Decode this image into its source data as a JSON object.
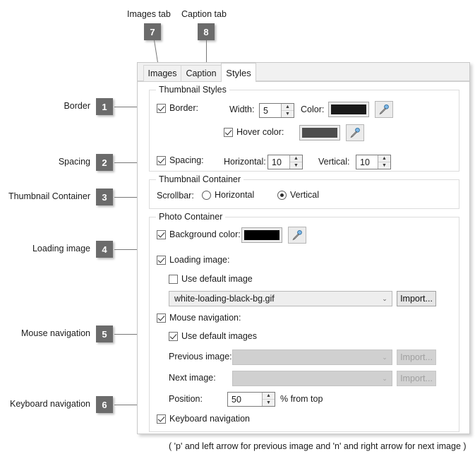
{
  "annotations": {
    "top": [
      {
        "label": "Images tab",
        "number": "7"
      },
      {
        "label": "Caption tab",
        "number": "8"
      }
    ],
    "left": [
      {
        "label": "Border",
        "number": "1"
      },
      {
        "label": "Spacing",
        "number": "2"
      },
      {
        "label": "Thumbnail Container",
        "number": "3"
      },
      {
        "label": "Loading image",
        "number": "4"
      },
      {
        "label": "Mouse navigation",
        "number": "5"
      },
      {
        "label": "Keyboard navigation",
        "number": "6"
      }
    ]
  },
  "tabs": [
    {
      "label": "Images",
      "active": false
    },
    {
      "label": "Caption",
      "active": false
    },
    {
      "label": "Styles",
      "active": true
    }
  ],
  "thumbnail_styles": {
    "title": "Thumbnail Styles",
    "border": {
      "label": "Border:",
      "checked": true,
      "width_label": "Width:",
      "width_value": "5",
      "color_label": "Color:",
      "color_value": "#1a1a1a",
      "picker_icon": "eyedropper-icon"
    },
    "hover": {
      "label": "Hover color:",
      "checked": true,
      "color_value": "#4d4d4d",
      "picker_icon": "eyedropper-icon"
    },
    "spacing": {
      "label": "Spacing:",
      "checked": true,
      "horizontal_label": "Horizontal:",
      "horizontal_value": "10",
      "vertical_label": "Vertical:",
      "vertical_value": "10"
    }
  },
  "thumbnail_container": {
    "title": "Thumbnail Container",
    "scrollbar_label": "Scrollbar:",
    "options": [
      {
        "label": "Horizontal",
        "selected": false
      },
      {
        "label": "Vertical",
        "selected": true
      }
    ]
  },
  "photo_container": {
    "title": "Photo Container",
    "background": {
      "label": "Background color:",
      "checked": true,
      "color_value": "#000000",
      "picker_icon": "eyedropper-icon"
    },
    "loading_image": {
      "label": "Loading image:",
      "checked": true,
      "use_default_label": "Use default image",
      "use_default_checked": false,
      "file_value": "white-loading-black-bg.gif",
      "import_label": "Import..."
    },
    "mouse_navigation": {
      "label": "Mouse navigation:",
      "checked": true,
      "use_default_images_label": "Use default images",
      "use_default_images_checked": true,
      "previous_label": "Previous image:",
      "previous_value": "",
      "previous_import_label": "Import...",
      "next_label": "Next image:",
      "next_value": "",
      "next_import_label": "Import...",
      "position_label": "Position:",
      "position_value": "50",
      "position_suffix": "% from top"
    },
    "keyboard_navigation": {
      "label": "Keyboard navigation",
      "checked": true,
      "hint": "( 'p' and left arrow for previous image and 'n' and right arrow for next image )"
    }
  },
  "icons": {
    "spin_up": "▲",
    "spin_down": "▼",
    "combo_arrow": "⌄"
  }
}
